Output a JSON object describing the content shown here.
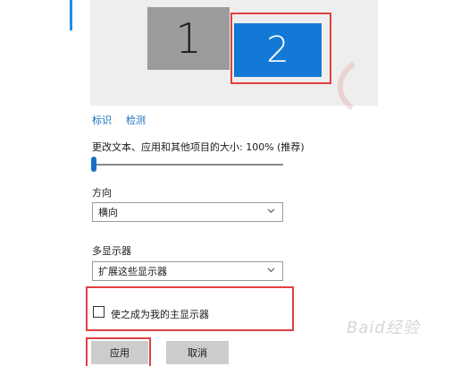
{
  "display": {
    "monitors": [
      {
        "label": "1",
        "selected": false
      },
      {
        "label": "2",
        "selected": true
      }
    ],
    "identify_link": "标识",
    "detect_link": "检测",
    "scale_label": "更改文本、应用和其他项目的大小: 100% (推荐)",
    "scale_value_percent": 100,
    "orientation_label": "方向",
    "orientation_value": "横向",
    "multi_display_label": "多显示器",
    "multi_display_value": "扩展这些显示器",
    "main_display_checkbox_label": "使之成为我的主显示器",
    "main_display_checked": false,
    "apply_button": "应用",
    "cancel_button": "取消"
  },
  "watermark": "Baid经验",
  "colors": {
    "accent": "#1479d6",
    "highlight": "#e04040",
    "monitor_unselected": "#9b9b9b"
  }
}
